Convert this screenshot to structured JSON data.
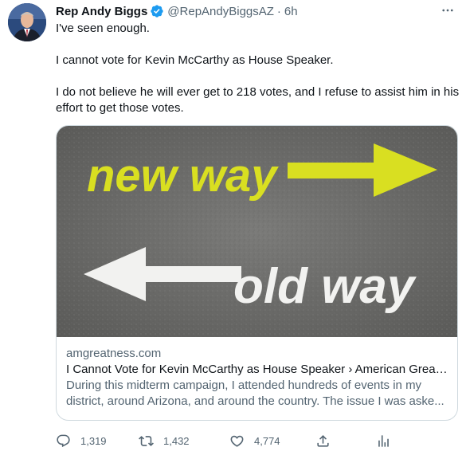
{
  "author": {
    "name": "Rep Andy Biggs",
    "handle": "@RepAndyBiggsAZ",
    "separator": "·",
    "time": "6h",
    "verified": true
  },
  "tweet_text": {
    "line1": "I've seen enough.",
    "line2": "I cannot vote for Kevin McCarthy as House Speaker.",
    "line3": "I do not believe he will ever get to 218 votes, and I refuse to assist him in his effort to get those votes."
  },
  "card": {
    "image_text_top": "new way",
    "image_text_bottom": "old way",
    "domain": "amgreatness.com",
    "title": "I Cannot Vote for Kevin McCarthy as House Speaker › American Great...",
    "description": "During this midterm campaign, I attended hundreds of events in my district, around Arizona, and around the country. The issue I was aske..."
  },
  "actions": {
    "replies": "1,319",
    "retweets": "1,432",
    "likes": "4,774"
  },
  "colors": {
    "accent": "#1d9bf0",
    "muted": "#536471",
    "border": "#cfd9de",
    "arrow_yellow": "#d9df21"
  },
  "icons": [
    "verified-badge-icon",
    "more-icon",
    "reply-icon",
    "retweet-icon",
    "like-icon",
    "share-icon",
    "analytics-icon"
  ]
}
